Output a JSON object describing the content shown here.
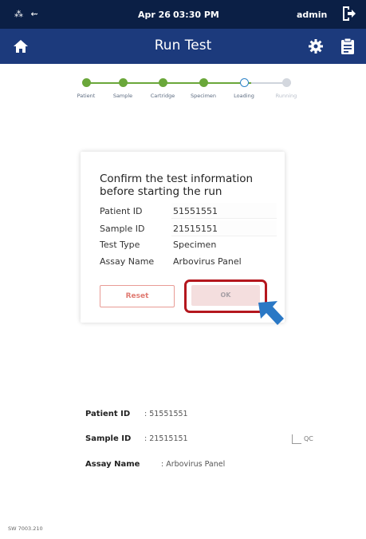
{
  "status_bar": {
    "date": "Apr 26",
    "time": "03:30 PM",
    "user": "admin",
    "icons": [
      "network-icon",
      "usb-icon"
    ]
  },
  "title_bar": {
    "title": "Run Test"
  },
  "stepper": {
    "steps": [
      {
        "label": "Patient",
        "state": "done"
      },
      {
        "label": "Sample",
        "state": "done"
      },
      {
        "label": "Cartridge",
        "state": "done"
      },
      {
        "label": "Specimen",
        "state": "done"
      },
      {
        "label": "Loading",
        "state": "current"
      },
      {
        "label": "Running",
        "state": "pending"
      }
    ]
  },
  "dialog": {
    "heading": "Confirm the test information before starting the run",
    "rows": [
      {
        "label": "Patient ID",
        "value": "51551551"
      },
      {
        "label": "Sample ID",
        "value": "21515151"
      },
      {
        "label": "Test Type",
        "value": "Specimen"
      },
      {
        "label": "Assay Name",
        "value": "Arbovirus Panel"
      }
    ],
    "reset_label": "Reset",
    "ok_label": "OK"
  },
  "summary": {
    "patient_id_label": "Patient ID",
    "patient_id_value": ": 51551551",
    "sample_id_label": "Sample ID",
    "sample_id_value": ": 21515151",
    "assay_name_label": "Assay Name",
    "assay_name_value": ": Arbovirus Panel",
    "qc_label": "QC"
  },
  "footer": {
    "sw_version": "SW 7003.210"
  },
  "colors": {
    "status_bar_bg": "#0b1f45",
    "title_bar_bg": "#1c3a7c",
    "step_done": "#6aa73a",
    "step_current": "#2f84c8",
    "highlight": "#b4171e",
    "cursor": "#2a78c5"
  }
}
